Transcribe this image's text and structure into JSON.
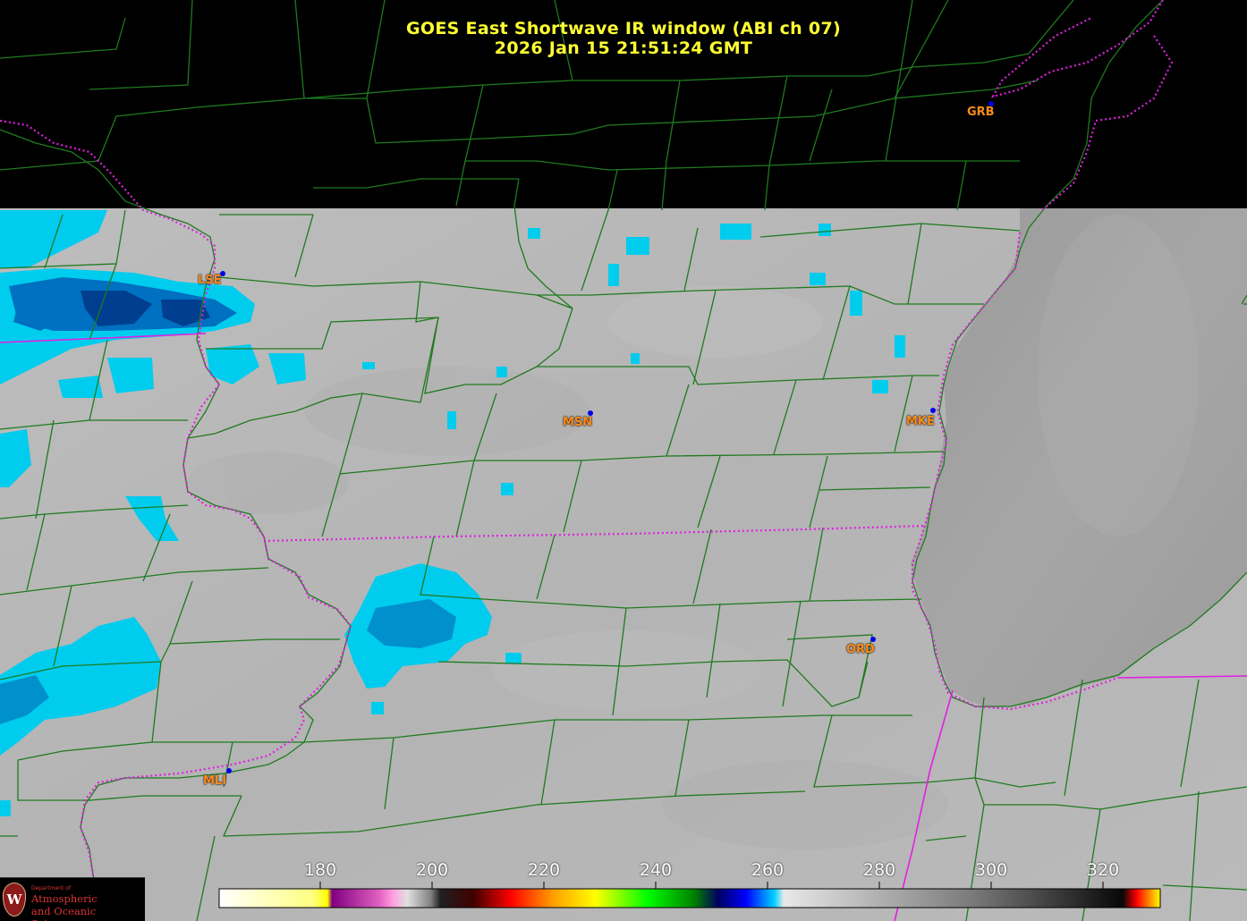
{
  "title": {
    "line1": "GOES East Shortwave IR window (ABI ch 07)",
    "line2": "2026 Jan 15  21:51:24 GMT"
  },
  "cities": [
    {
      "id": "grb",
      "label": "GRB"
    },
    {
      "id": "lse",
      "label": "LSE"
    },
    {
      "id": "msn",
      "label": "MSN"
    },
    {
      "id": "mke",
      "label": "MKE"
    },
    {
      "id": "ord",
      "label": "ORD"
    },
    {
      "id": "mli",
      "label": "MLI"
    }
  ],
  "colorbar": {
    "ticks": [
      "180",
      "200",
      "220",
      "240",
      "260",
      "280",
      "300",
      "320"
    ],
    "unit_min": 170,
    "unit_max": 330
  },
  "logo": {
    "seal": "W",
    "dept": "Department of",
    "line1": "Atmospheric",
    "line2": "and Oceanic Sciences"
  },
  "colors": {
    "title": "#ffff33",
    "city_label": "#ff8c1a",
    "county_lines": "#1f7a1f",
    "state_lines": "#e020e0",
    "cloud_cyan": "#00d4f0",
    "cloud_blue": "#0050a0",
    "no_data": "#000000"
  }
}
